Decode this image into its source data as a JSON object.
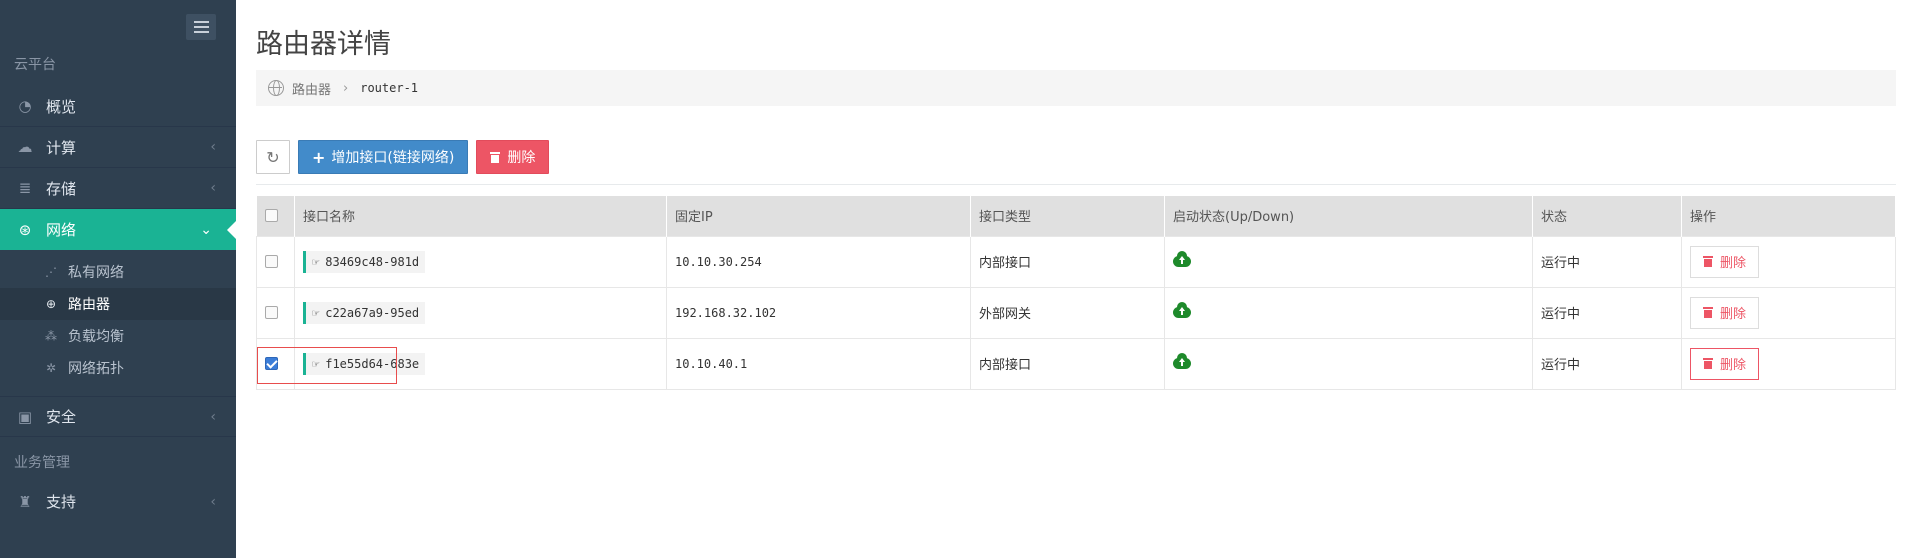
{
  "sidebar": {
    "section_cloud": "云平台",
    "section_business": "业务管理",
    "items": {
      "overview": "概览",
      "compute": "计算",
      "storage": "存储",
      "network": "网络",
      "security": "安全",
      "support": "支持"
    },
    "network_sub": {
      "private_network": "私有网络",
      "router": "路由器",
      "load_balancer": "负载均衡",
      "topology": "网络拓扑"
    }
  },
  "page": {
    "title": "路由器详情",
    "breadcrumb_root": "路由器",
    "breadcrumb_current": "router-1"
  },
  "toolbar": {
    "add_interface": "增加接口(链接网络)",
    "delete": "删除"
  },
  "table": {
    "headers": {
      "name": "接口名称",
      "ip": "固定IP",
      "type": "接口类型",
      "admin_state": "启动状态(Up/Down)",
      "status": "状态",
      "actions": "操作"
    },
    "rows": [
      {
        "name": "83469c48-981d",
        "ip": "10.10.30.254",
        "type": "内部接口",
        "admin_state": "up",
        "status": "运行中",
        "action": "删除",
        "selected": false
      },
      {
        "name": "c22a67a9-95ed",
        "ip": "192.168.32.102",
        "type": "外部网关",
        "admin_state": "up",
        "status": "运行中",
        "action": "删除",
        "selected": false
      },
      {
        "name": "f1e55d64-683e",
        "ip": "10.10.40.1",
        "type": "内部接口",
        "admin_state": "up",
        "status": "运行中",
        "action": "删除",
        "selected": true
      }
    ]
  },
  "colors": {
    "sidebar_bg": "#2f4050",
    "accent": "#1ab394",
    "primary": "#428bca",
    "danger": "#ed5565",
    "up_green": "#1e8a2b"
  }
}
